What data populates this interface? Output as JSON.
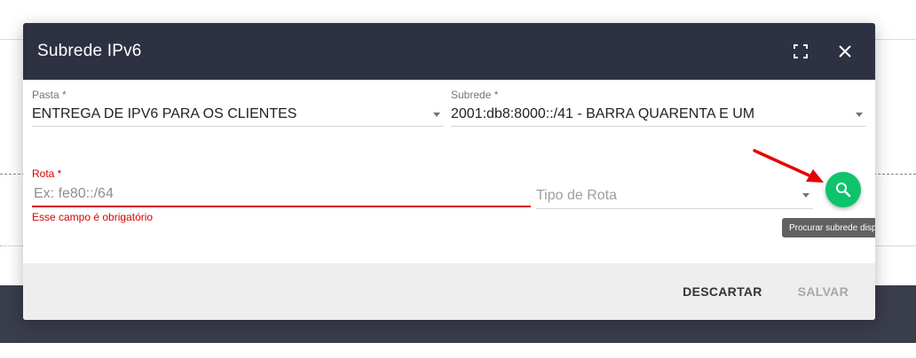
{
  "dialog": {
    "title": "Subrede IPv6",
    "fullscreen_icon": "fullscreen-icon",
    "close_icon": "close-icon"
  },
  "form": {
    "pasta": {
      "label": "Pasta *",
      "value": "ENTREGA DE IPV6 PARA OS CLIENTES"
    },
    "subrede": {
      "label": "Subrede *",
      "value": "2001:db8:8000::/41 - BARRA QUARENTA E UM"
    },
    "rota": {
      "label": "Rota *",
      "value": "",
      "placeholder": "Ex: fe80::/64",
      "error": "Esse campo é obrigatório"
    },
    "tipo_rota": {
      "placeholder": "Tipo de Rota"
    },
    "search_button": {
      "icon": "search-icon",
      "tooltip": "Procurar subrede disponível"
    }
  },
  "footer": {
    "discard_label": "DESCARTAR",
    "save_label": "SALVAR"
  },
  "colors": {
    "header_bg": "#2d3142",
    "fab": "#0ec46b",
    "error": "#d50000",
    "arrow": "#e60000"
  }
}
